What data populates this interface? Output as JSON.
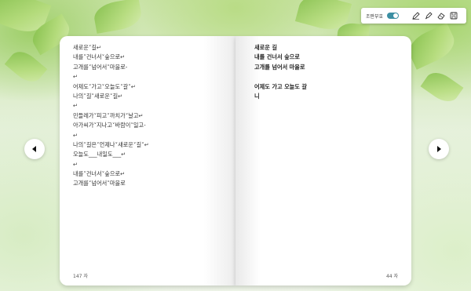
{
  "toolbar": {
    "symbol_toggle_label": "조판부호",
    "symbol_toggle_on": true,
    "tools": [
      "pen-icon",
      "highlighter-icon",
      "eraser-icon",
      "save-icon"
    ]
  },
  "left_page": {
    "lines": [
      "새로운˅길↵",
      "내를˅건너서˅숲으로↵",
      "고개를˅넘어서˅마을로-",
      "↵",
      "어제도˅가고˅오늘도˅갈˅↵",
      "나의˅길˅새로운˅길↵",
      "↵",
      "민들레가˅피고˅까치가˅날고↵",
      "아가씨가˅지나고˅바람이˅일고-",
      "↵",
      "나의˅길은˅언제나˅새로운˅길˅↵",
      "오늘도___내일도___↵",
      "↵",
      "내를˅건너서˅숲으로↵",
      "고개를˅넘어서˅마을로"
    ],
    "char_count": "147 자"
  },
  "right_page": {
    "lines": [
      "새로운 길",
      "내를 건너서 숲으로",
      "고개를 넘어서 마을로",
      "",
      "어제도 가고 오늘도 갈",
      "니"
    ],
    "char_count": "44 자"
  },
  "navigation": {
    "prev_icon": "chevron-left-icon",
    "next_icon": "chevron-right-icon"
  }
}
